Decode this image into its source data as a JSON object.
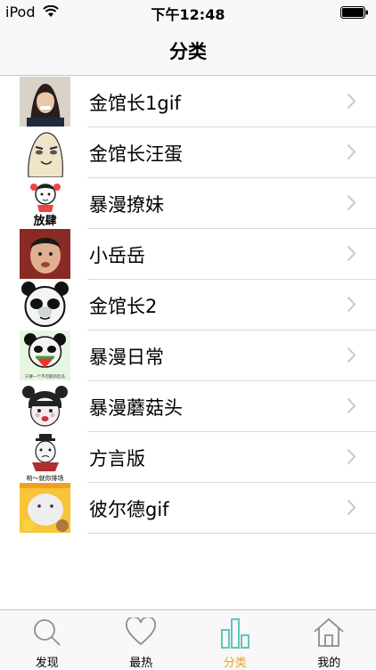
{
  "status_bar": {
    "carrier": "iPod",
    "time": "下午12:48"
  },
  "nav": {
    "title": "分类"
  },
  "categories": [
    {
      "label": "金馆长1gif",
      "thumb_caption": ""
    },
    {
      "label": "金馆长汪蛋",
      "thumb_caption": ""
    },
    {
      "label": "暴漫撩妹",
      "thumb_caption": "放肆"
    },
    {
      "label": "小岳岳",
      "thumb_caption": ""
    },
    {
      "label": "金馆长2",
      "thumb_caption": ""
    },
    {
      "label": "暴漫日常",
      "thumb_caption": "只要一个不可能的吃瓜"
    },
    {
      "label": "暴漫蘑菇头",
      "thumb_caption": ""
    },
    {
      "label": "方言版",
      "thumb_caption": "哟～就你排场"
    },
    {
      "label": "彼尔德gif",
      "thumb_caption": ""
    }
  ],
  "tabs": [
    {
      "label": "发现",
      "icon": "search-icon"
    },
    {
      "label": "最热",
      "icon": "heart-icon"
    },
    {
      "label": "分类",
      "icon": "bar-chart-icon",
      "active": true
    },
    {
      "label": "我的",
      "icon": "home-icon"
    }
  ],
  "colors": {
    "active_tab": "#f0a020",
    "accent_icon": "#4ec0b6"
  }
}
